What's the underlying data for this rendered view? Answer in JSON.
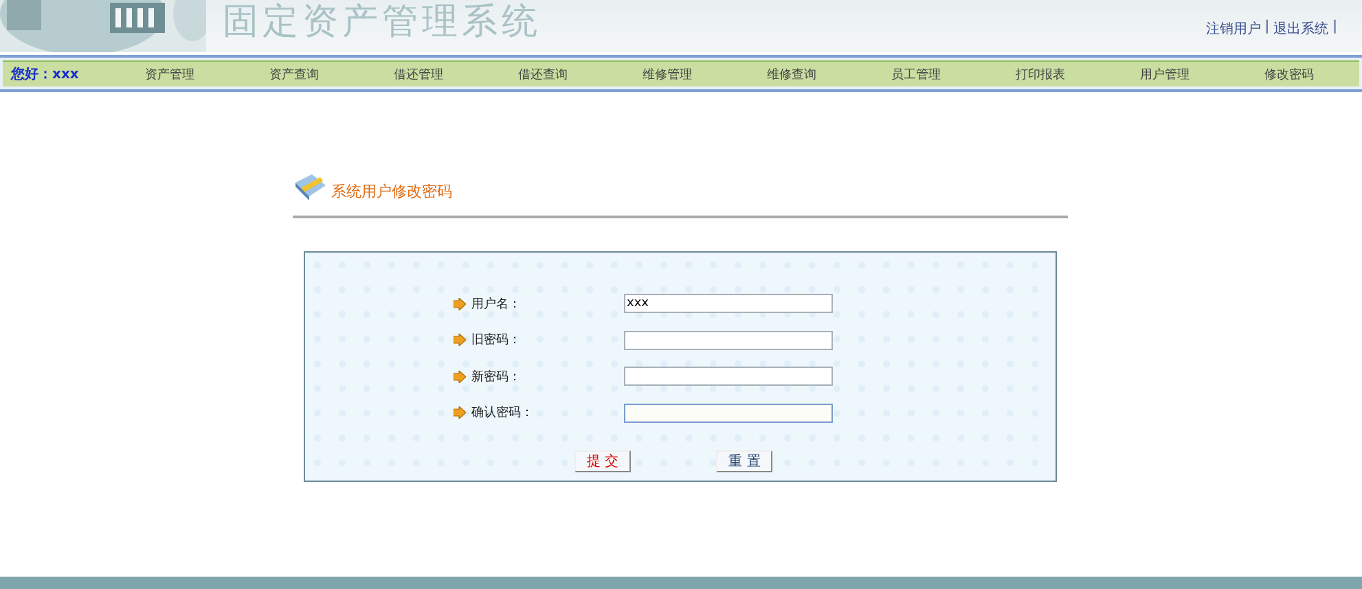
{
  "header": {
    "title": "固定资产管理系统",
    "links": [
      "注销用户",
      "退出系统"
    ],
    "separator": "|"
  },
  "nav": {
    "greeting": "您好：xxx",
    "items": [
      "资产管理",
      "资产查询",
      "借还管理",
      "借还查询",
      "维修管理",
      "维修查询",
      "员工管理",
      "打印报表",
      "用户管理",
      "修改密码"
    ]
  },
  "section": {
    "title": "系统用户修改密码"
  },
  "form": {
    "fields": [
      {
        "label": "用户名：",
        "value": "xxx",
        "focused": false
      },
      {
        "label": "旧密码：",
        "focused": false
      },
      {
        "label": "新密码：",
        "focused": false
      },
      {
        "label": "确认密码：",
        "focused": true
      }
    ],
    "buttons": [
      {
        "label": "提 交",
        "kind": "submit"
      },
      {
        "label": "重 置",
        "kind": "reset"
      }
    ]
  }
}
